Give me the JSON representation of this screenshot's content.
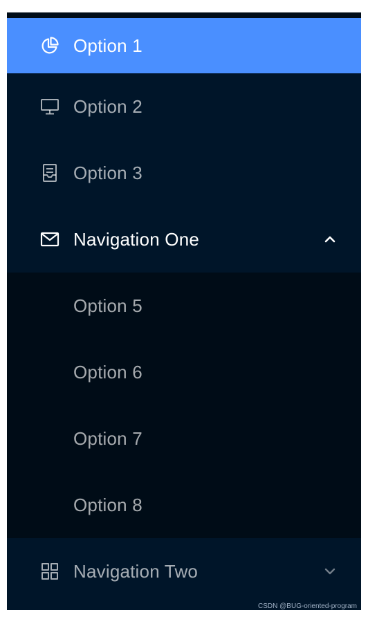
{
  "menu": {
    "items": [
      {
        "label": "Option 1",
        "icon": "pie-chart-icon",
        "selected": true
      },
      {
        "label": "Option 2",
        "icon": "desktop-icon"
      },
      {
        "label": "Option 3",
        "icon": "inbox-icon"
      }
    ],
    "submenus": [
      {
        "label": "Navigation One",
        "icon": "mail-icon",
        "expanded": true,
        "children": [
          "Option 5",
          "Option 6",
          "Option 7",
          "Option 8"
        ]
      },
      {
        "label": "Navigation Two",
        "icon": "appstore-icon",
        "expanded": false
      }
    ]
  },
  "colors": {
    "menu_bg": "#001529",
    "submenu_bg": "#000c17",
    "selected_bg": "#4a8fff",
    "text_muted": "rgba(255,255,255,0.65)",
    "text_active": "#ffffff"
  },
  "watermark": "CSDN @BUG-oriented-program"
}
